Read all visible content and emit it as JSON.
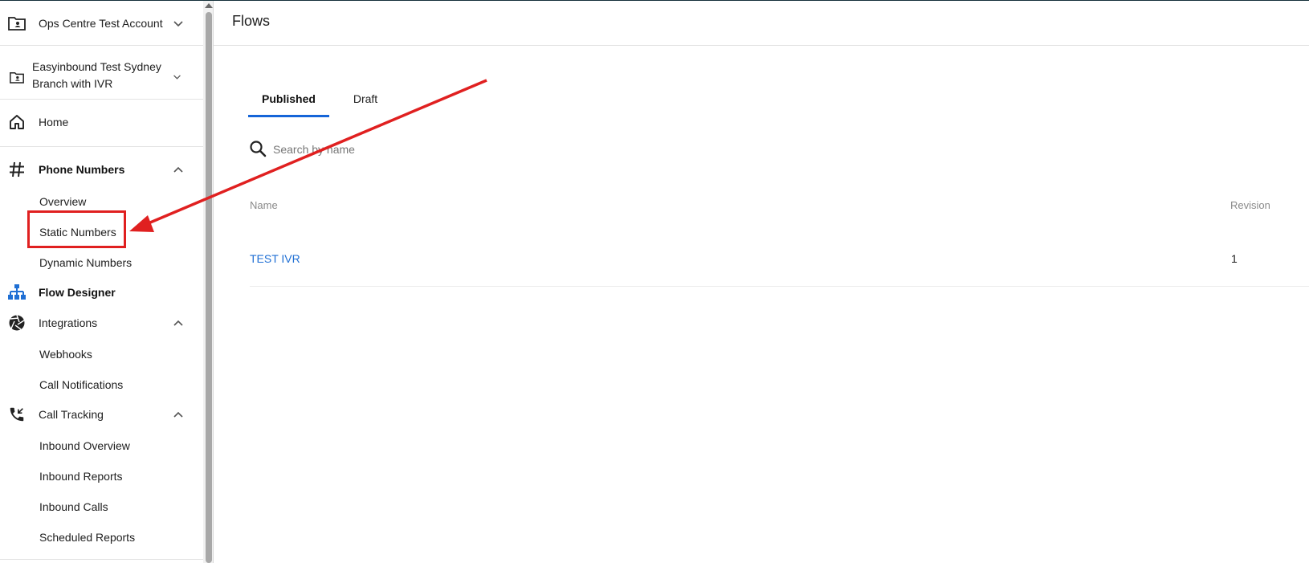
{
  "colors": {
    "accent": "#1565d8",
    "link": "#1f6fd4",
    "annotation": "#e02020"
  },
  "sidebar": {
    "account": {
      "label": "Ops Centre Test Account",
      "icon": "folder-account-icon"
    },
    "branch": {
      "line1": "Easyinbound Test Sydney",
      "line2": "Branch with IVR",
      "icon": "folder-account-icon"
    },
    "home": {
      "label": "Home",
      "icon": "home-icon"
    },
    "phone_numbers": {
      "label": "Phone Numbers",
      "icon": "hash-icon",
      "items": [
        "Overview",
        "Static Numbers",
        "Dynamic Numbers"
      ]
    },
    "flow_designer": {
      "label": "Flow Designer",
      "icon": "sitemap-icon"
    },
    "integrations": {
      "label": "Integrations",
      "icon": "aperture-icon",
      "items": [
        "Webhooks",
        "Call Notifications"
      ]
    },
    "call_tracking": {
      "label": "Call Tracking",
      "icon": "phone-incoming-icon",
      "items": [
        "Inbound Overview",
        "Inbound Reports",
        "Inbound Calls",
        "Scheduled Reports"
      ]
    }
  },
  "main": {
    "title": "Flows",
    "tabs": [
      {
        "label": "Published",
        "active": true
      },
      {
        "label": "Draft",
        "active": false
      }
    ],
    "search": {
      "placeholder": "Search by name",
      "value": ""
    },
    "table": {
      "columns": [
        "Name",
        "Revision"
      ],
      "rows": [
        {
          "name": "TEST IVR",
          "revision": "1"
        }
      ]
    }
  }
}
